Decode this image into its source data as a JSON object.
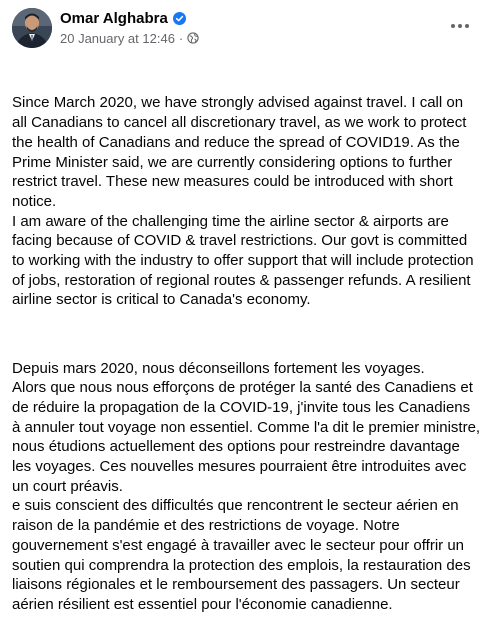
{
  "post": {
    "author_name": "Omar Alghabra",
    "timestamp": "20 January at 12:46",
    "separator": "·",
    "icons": {
      "verified": "verified-badge-icon",
      "audience": "globe-icon",
      "menu": "more-options-icon"
    },
    "colors": {
      "verified": "#1877f2",
      "secondary_text": "#65676b"
    },
    "body": {
      "paragraph_en": "Since March 2020, we have strongly advised against travel. I call on all Canadians to cancel all discretionary travel, as we work to protect the health of Canadians and reduce the spread of COVID19. As the Prime Minister said, we are currently considering options to further restrict travel. These new measures could be introduced with short notice.\nI am aware of the challenging time the airline sector & airports are facing because of COVID & travel restrictions. Our govt is committed to working with the industry to offer support that will include protection of jobs, restoration of regional routes & passenger refunds. A resilient airline sector is critical to Canada's economy.",
      "paragraph_fr": "Depuis mars 2020, nous déconseillons fortement les voyages.\nAlors que nous nous efforçons de protéger la santé des Canadiens et de réduire la propagation de la COVID-19, j'invite tous les Canadiens à annuler tout voyage non essentiel. Comme l'a dit le premier ministre, nous étudions actuellement des options pour restreindre davantage les voyages. Ces nouvelles mesures pourraient être introduites avec un court préavis.\ne suis conscient des difficultés que rencontrent le secteur aérien en raison de la pandémie et des restrictions de voyage. Notre gouvernement s'est engagé à travailler avec le secteur pour offrir un soutien qui comprendra la protection des emplois, la restauration des liaisons régionales et le remboursement des passagers. Un secteur aérien résilient est essentiel pour l'économie canadienne."
    }
  }
}
